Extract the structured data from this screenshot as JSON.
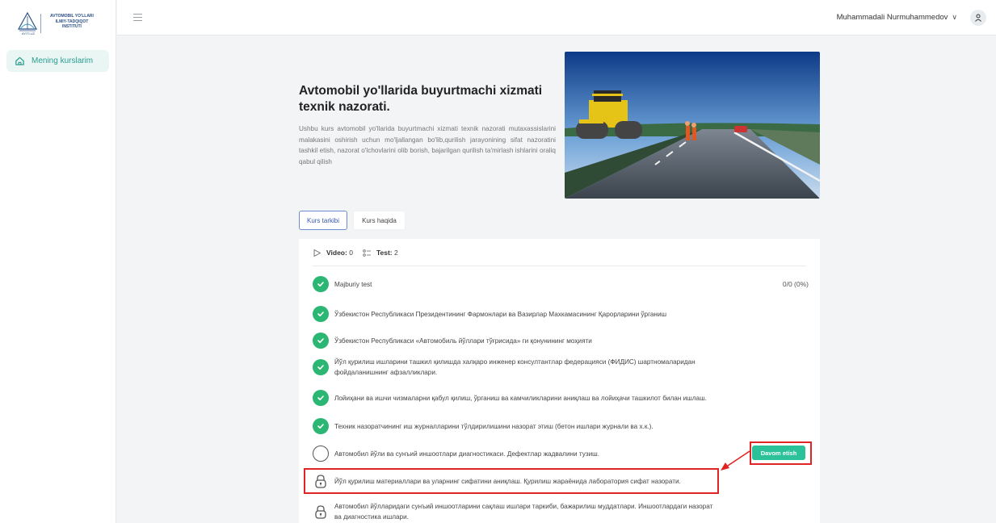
{
  "header": {
    "user_name": "Muhammadali Nurmuhammedov",
    "chevron": "∨"
  },
  "logo": {
    "text_line1": "AVTOMOBIL YO'LLARI",
    "text_line2": "ILMIY-TADQIQOT",
    "text_line3": "INSTITUTI",
    "abbr": "AYITI.UZ"
  },
  "sidebar": {
    "items": [
      {
        "label": "Mening kurslarim",
        "icon": "home-icon"
      }
    ]
  },
  "course": {
    "title": "Avtomobil yo'llarida buyurtmachi xizmati texnik nazorati.",
    "description": "Ushbu kurs avtomobil yo'llarida buyurtmachi xizmati texnik nazorati mutaxassislarini malakasini oshirish uchun mo'ljallangan bo'lib,qurilish jarayonining sifat nazoratini tashkil etish, nazorat o'lchovlarini olib borish, bajarilgan qurilish ta'mirlash ishlarini oraliq qabul qilish"
  },
  "tabs": [
    {
      "label": "Kurs tarkibi",
      "active": true
    },
    {
      "label": "Kurs haqida",
      "active": false
    }
  ],
  "stats": {
    "video_label": "Video:",
    "video_count": "0",
    "test_label": "Test:",
    "test_count": "2"
  },
  "lessons": [
    {
      "title": "Majburiy test",
      "status": "done",
      "progress": "0/0 (0%)"
    },
    {
      "title": "Ўзбекистон Республикаси Президентининг Фармонлари ва Вазирлар Махкамасининг Қарорларини ўрганиш",
      "status": "done"
    },
    {
      "title": "Ўзбекистон Республикаси «Автомобиль йўллари тўғрисида» ги қонунининг моҳияти",
      "status": "done"
    },
    {
      "title": "Йўл қурилиш ишларини ташкил қилишда халқаро инженер консултантлар федерацияси (ФИДИС) шартномаларидан фойдаланишнинг афзалликлари.",
      "status": "done"
    },
    {
      "title": "Лойиҳани ва ишчи чизмаларни қабул қилиш, ўрганиш ва камчиликларини аниқлаш ва лойиҳачи ташкилот билан ишлаш.",
      "status": "done"
    },
    {
      "title": "Техник назоратчининг иш журналларини тўлдирилишини назорат этиш (бетон ишлари журнали ва х.к.).",
      "status": "done"
    },
    {
      "title": "Автомобил йўли ва сунъий иншоотлари диагностикаси. Дефектлар жадвалини тузиш.",
      "status": "current"
    },
    {
      "title": "Йўл қурилиш материаллари ва уларнинг сифатини аниқлаш. Қурилиш жараёнида лаборатория сифат назорати.",
      "status": "locked"
    },
    {
      "title": "Автомобил йўлларидаги сунъий иншоотларини сақлаш ишлари таркиби, бажарилиш муддатлари. Иншоотлардаги назорат ва диагностика ишлари.",
      "status": "locked"
    }
  ],
  "continue_button": "Davom etish",
  "colors": {
    "accent": "#2a9d8f",
    "success": "#2bb673",
    "button": "#2bc29a",
    "highlight": "#e02424",
    "tab_active": "#6d8bd4"
  }
}
